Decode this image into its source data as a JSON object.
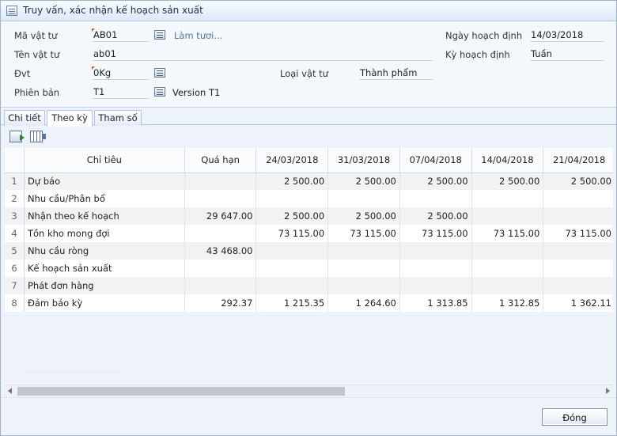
{
  "window": {
    "title": "Truy vấn, xác nhận kế hoạch sản xuất"
  },
  "form": {
    "ma_vat_tu": {
      "label": "Mã vật tư",
      "value": "AB01",
      "action": "Làm tươi..."
    },
    "ten_vat_tu": {
      "label": "Tên vật tư",
      "value": "ab01"
    },
    "dvt": {
      "label": "Đvt",
      "value": "0Kg"
    },
    "phien_ban": {
      "label": "Phiên bản",
      "value": "T1",
      "description": "Version T1"
    },
    "loai_vat_tu": {
      "label": "Loại vật tư",
      "value": "Thành phẩm"
    },
    "ngay_hoach_dinh": {
      "label": "Ngày hoạch định",
      "value": "14/03/2018"
    },
    "ky_hoach_dinh": {
      "label": "Kỳ hoạch định",
      "value": "Tuần"
    }
  },
  "tabs": [
    {
      "label": "Chi tiết",
      "active": false
    },
    {
      "label": "Theo kỳ",
      "active": true
    },
    {
      "label": "Tham số",
      "active": false
    }
  ],
  "toolbar": {
    "icons": [
      "export-icon",
      "columns-icon"
    ]
  },
  "grid": {
    "headers": [
      "Chỉ tiêu",
      "Quá hạn",
      "24/03/2018",
      "31/03/2018",
      "07/04/2018",
      "14/04/2018",
      "21/04/2018"
    ],
    "rows": [
      {
        "no": "1",
        "name": "Dự báo",
        "qua_han": "",
        "v1": "2 500.00",
        "v2": "2 500.00",
        "v3": "2 500.00",
        "v4": "2 500.00",
        "v5": "2 500.00"
      },
      {
        "no": "2",
        "name": "Nhu cầu/Phân bổ",
        "qua_han": "",
        "v1": "",
        "v2": "",
        "v3": "",
        "v4": "",
        "v5": ""
      },
      {
        "no": "3",
        "name": "Nhận theo kế hoạch",
        "qua_han": "29 647.00",
        "v1": "2 500.00",
        "v2": "2 500.00",
        "v3": "2 500.00",
        "v4": "",
        "v5": ""
      },
      {
        "no": "4",
        "name": "Tồn kho mong đợi",
        "qua_han": "",
        "v1": "73 115.00",
        "v2": "73 115.00",
        "v3": "73 115.00",
        "v4": "73 115.00",
        "v5": "73 115.00"
      },
      {
        "no": "5",
        "name": "Nhu cầu ròng",
        "qua_han": "43 468.00",
        "v1": "",
        "v2": "",
        "v3": "",
        "v4": "",
        "v5": ""
      },
      {
        "no": "6",
        "name": "Kế hoạch sản xuất",
        "qua_han": "",
        "v1": "",
        "v2": "",
        "v3": "",
        "v4": "",
        "v5": ""
      },
      {
        "no": "7",
        "name": "Phát đơn hàng",
        "qua_han": "",
        "v1": "",
        "v2": "",
        "v3": "",
        "v4": "",
        "v5": ""
      },
      {
        "no": "8",
        "name": "Đảm bảo kỳ",
        "qua_han": "292.37",
        "v1": "1 215.35",
        "v2": "1 264.60",
        "v3": "1 313.85",
        "v4": "1 312.85",
        "v5": "1 362.11"
      }
    ]
  },
  "footer": {
    "close_label": "Đóng"
  }
}
